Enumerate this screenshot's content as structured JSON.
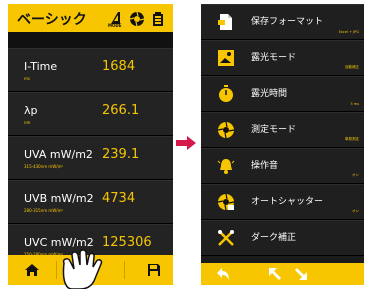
{
  "left_screen": {
    "title": "ベーシック",
    "mode_caption": "MODE",
    "rows": [
      {
        "label": "I-Time",
        "sub": "ms",
        "value": "1684"
      },
      {
        "label": "λp",
        "sub": "nm",
        "value": "266.1"
      },
      {
        "label": "UVA mW/m2",
        "sub": "315-430nm mW/m²",
        "value": "239.1"
      },
      {
        "label": "UVB mW/m2",
        "sub": "280-315nm mW/m²",
        "value": "4734"
      },
      {
        "label": "UVC mW/m2",
        "sub": "250-280nm mW/m²",
        "value": "125306"
      }
    ],
    "footer_icons": [
      "home-icon",
      "tap-icon",
      "save-icon"
    ]
  },
  "arrow": {
    "color": "#d6184a"
  },
  "right_screen": {
    "menu": [
      {
        "label": "保存フォーマット",
        "value": "Excel + JPG",
        "icon": "document-icon"
      },
      {
        "label": "露光モード",
        "value": "自動補正",
        "icon": "exposure-icon"
      },
      {
        "label": "露光時間",
        "value": "3 ms",
        "icon": "timer-icon"
      },
      {
        "label": "測定モード",
        "value": "単発測定",
        "icon": "aperture-icon"
      },
      {
        "label": "操作音",
        "value": "オン",
        "icon": "bell-icon"
      },
      {
        "label": "オートシャッター",
        "value": "オン",
        "icon": "auto-shutter-icon"
      },
      {
        "label": "ダーク補正",
        "value": "",
        "icon": "tools-icon"
      }
    ],
    "footer_icons": [
      "back-icon",
      "arrow-up-left-icon",
      "arrow-down-right-icon"
    ]
  },
  "colors": {
    "accent": "#f7c600",
    "background": "#1b1b1b",
    "arrow": "#d6184a"
  }
}
